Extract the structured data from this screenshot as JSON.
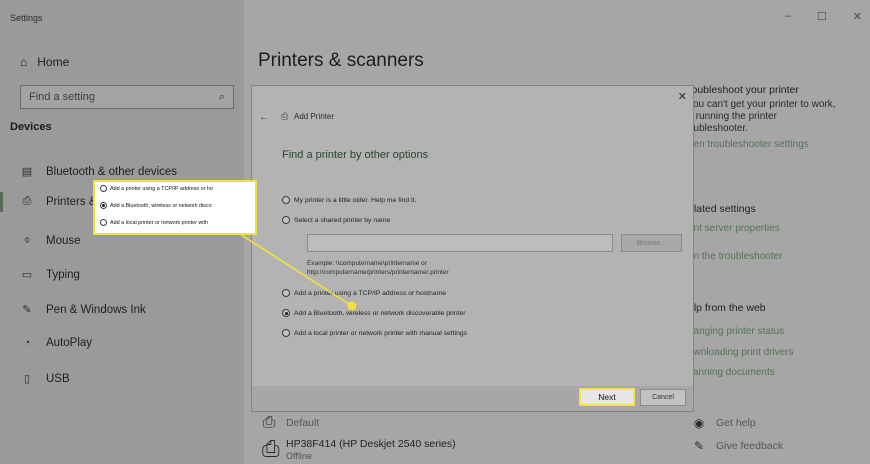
{
  "window": {
    "app_title": "Settings",
    "controls": {
      "minimize": "–",
      "maximize": "☐",
      "close": "✕"
    }
  },
  "sidebar": {
    "home_label": "Home",
    "search_placeholder": "Find a setting",
    "section_title": "Devices",
    "items": [
      {
        "label": "Bluetooth & other devices",
        "icon": "bluetooth-devices-icon"
      },
      {
        "label": "Printers & scanners",
        "icon": "printer-icon"
      },
      {
        "label": "Mouse",
        "icon": "mouse-icon"
      },
      {
        "label": "Typing",
        "icon": "keyboard-icon"
      },
      {
        "label": "Pen & Windows Ink",
        "icon": "pen-icon"
      },
      {
        "label": "AutoPlay",
        "icon": "autoplay-icon"
      },
      {
        "label": "USB",
        "icon": "usb-icon"
      }
    ]
  },
  "main": {
    "page_title": "Printers & scanners",
    "printers": [
      {
        "name": "Default"
      },
      {
        "name": "HP38F414 (HP Deskjet 2540 series)",
        "status": "Offline"
      }
    ]
  },
  "right_panel": {
    "troubleshoot_heading": "roubleshoot your printer",
    "troubleshoot_text": [
      "you can't get your printer to work,",
      "y running the printer",
      "oubleshooter."
    ],
    "troubleshoot_link": "pen troubleshooter settings",
    "related_heading": "elated settings",
    "related_links": [
      "rint server properties",
      "un the troubleshooter"
    ],
    "web_heading": "elp from the web",
    "web_links": [
      "hanging printer status",
      "ownloading print drivers",
      "canning documents"
    ],
    "get_help": "Get help",
    "give_feedback": "Give feedback"
  },
  "dialog": {
    "header": "Add Printer",
    "title": "Find a printer by other options",
    "options": [
      {
        "label": "My printer is a little older. Help me find it.",
        "selected": false
      },
      {
        "label": "Select a shared printer by name",
        "selected": false
      },
      {
        "label": "Add a printer using a TCP/IP address or hostname",
        "selected": false
      },
      {
        "label": "Add a Bluetooth, wireless or network discoverable printer",
        "selected": true
      },
      {
        "label": "Add a local printer or network printer with manual settings",
        "selected": false
      }
    ],
    "browse_label": "Browse...",
    "example_line1": "Example: \\\\computername\\printername or",
    "example_line2": "http://computername/printers/printername/.printer",
    "next_label": "Next",
    "cancel_label": "Cancel",
    "close_label": "✕"
  },
  "callout": {
    "options": [
      {
        "label": "Add a printer using a TCP/IP address or ho",
        "selected": false
      },
      {
        "label": "Add a Bluetooth, wireless or network disco",
        "selected": true
      },
      {
        "label": "Add a local printer or network printer with",
        "selected": false
      }
    ]
  },
  "colors": {
    "highlight": "#f0e23c",
    "dim_overlay": "#9a9a9a",
    "link_green": "#557355"
  }
}
